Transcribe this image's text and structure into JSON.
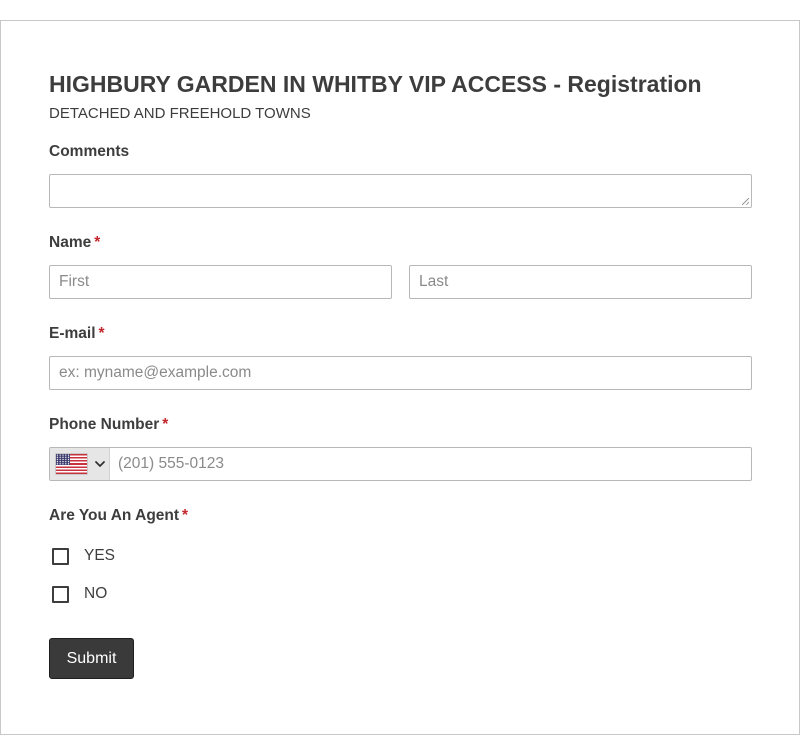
{
  "form": {
    "title": "HIGHBURY GARDEN IN WHITBY VIP ACCESS - Registration",
    "subtitle": "DETACHED AND FREEHOLD TOWNS",
    "comments": {
      "label": "Comments",
      "value": ""
    },
    "name": {
      "label": "Name",
      "required_mark": "*",
      "first_placeholder": "First",
      "last_placeholder": "Last",
      "first_value": "",
      "last_value": ""
    },
    "email": {
      "label": "E-mail",
      "required_mark": "*",
      "placeholder": "ex: myname@example.com",
      "value": ""
    },
    "phone": {
      "label": "Phone Number",
      "required_mark": "*",
      "country_flag": "us-flag-icon",
      "placeholder": "(201) 555-0123",
      "value": ""
    },
    "agent": {
      "label": "Are You An Agent",
      "required_mark": "*",
      "options": [
        {
          "label": "YES",
          "checked": false
        },
        {
          "label": "NO",
          "checked": false
        }
      ]
    },
    "submit_label": "Submit"
  },
  "colors": {
    "required": "#c3272b",
    "button_bg": "#3a3a3a",
    "text": "#3d3d3d",
    "border": "#b8b8b8"
  }
}
